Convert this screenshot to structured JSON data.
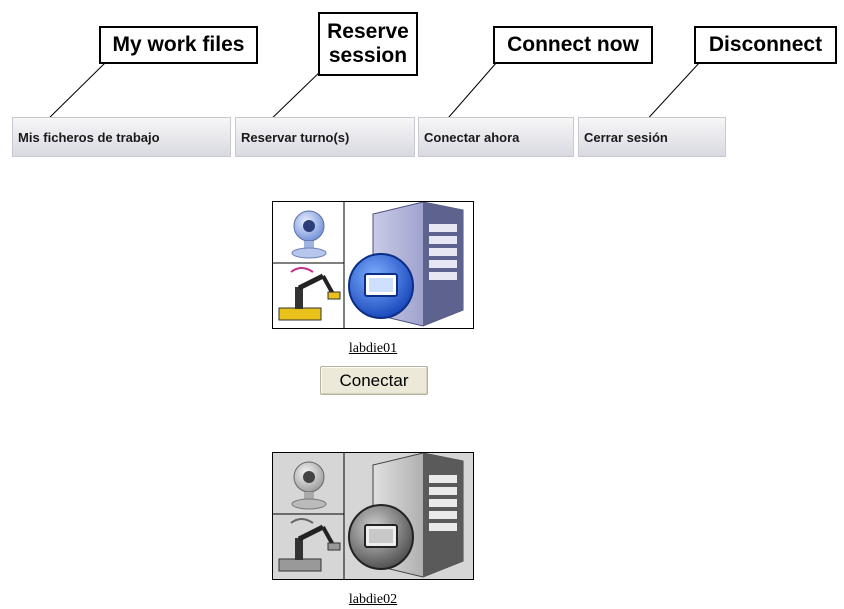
{
  "callouts": {
    "my_work_files": "My work files",
    "reserve_session": "Reserve\nsession",
    "connect_now": "Connect now",
    "disconnect": "Disconnect"
  },
  "menu": {
    "my_files": "Mis ficheros de trabajo",
    "reserve": "Reservar turno(s)",
    "connect_now": "Conectar ahora",
    "logout": "Cerrar sesión"
  },
  "labs": [
    {
      "name": "labdie01",
      "state": "available",
      "button_label": "Conectar",
      "icon": "webcam-robot-server-icon"
    },
    {
      "name": "labdie02",
      "state": "unavailable",
      "icon": "webcam-robot-server-icon-grayscale"
    }
  ],
  "colors": {
    "active_accent": "#2f63c9",
    "server_body": "#9b9fc8",
    "disabled_gray": "#8a8a8a"
  }
}
